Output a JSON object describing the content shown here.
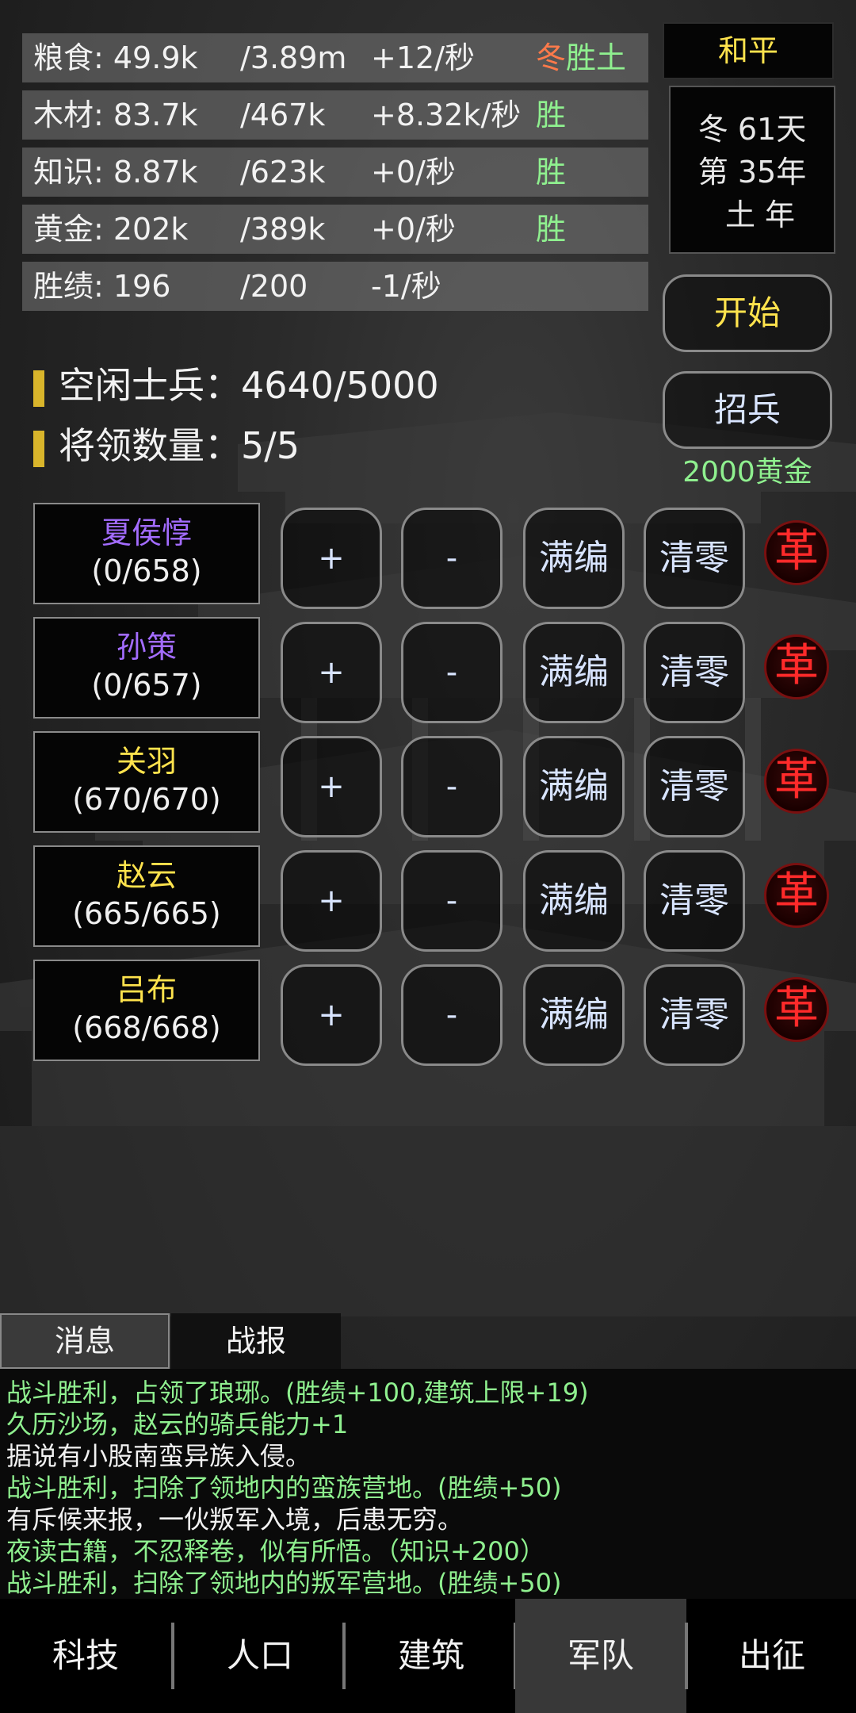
{
  "resources": [
    {
      "name": "粮食: 49.9k",
      "max": "/3.89m",
      "rate": "+12/秒",
      "tag_winter": "冬",
      "tag_victory": "胜",
      "tag_earth": "土"
    },
    {
      "name": "木材: 83.7k",
      "max": "/467k",
      "rate": "+8.32k/秒",
      "tag": "胜"
    },
    {
      "name": "知识: 8.87k",
      "max": "/623k",
      "rate": "+0/秒",
      "tag": "胜"
    },
    {
      "name": "黄金: 202k",
      "max": "/389k",
      "rate": "+0/秒",
      "tag": "胜"
    },
    {
      "name": "胜绩: 196",
      "max": "/200",
      "rate": "-1/秒",
      "tag": ""
    }
  ],
  "status": {
    "peace": "和平",
    "calendar": [
      "冬 61天",
      "第 35年",
      "土 年"
    ]
  },
  "actions": {
    "start": "开始",
    "recruit": "招兵",
    "recruit_cost": "2000黄金"
  },
  "soldiers": {
    "idle": "空闲士兵：4640/5000",
    "generals_count": "将领数量：5/5"
  },
  "general_buttons": {
    "plus": "+",
    "minus": "-",
    "full": "满编",
    "clear": "清零",
    "remove": "革"
  },
  "generals": [
    {
      "name": "夏侯惇",
      "troops": "(0/658)",
      "color": "#a36cff"
    },
    {
      "name": "孙策",
      "troops": "(0/657)",
      "color": "#a36cff"
    },
    {
      "name": "关羽",
      "troops": "(670/670)",
      "color": "#ffe34d"
    },
    {
      "name": "赵云",
      "troops": "(665/665)",
      "color": "#ffe34d"
    },
    {
      "name": "吕布",
      "troops": "(668/668)",
      "color": "#ffe34d"
    }
  ],
  "tabs": {
    "messages": "消息",
    "battle": "战报"
  },
  "log": [
    {
      "text": "战斗胜利，占领了琅琊。(胜绩+100,建筑上限+19)",
      "color": "green"
    },
    {
      "text": "久历沙场，赵云的骑兵能力+1",
      "color": "green"
    },
    {
      "text": "据说有小股南蛮异族入侵。",
      "color": "white"
    },
    {
      "text": "战斗胜利，扫除了领地内的蛮族营地。(胜绩+50)",
      "color": "green"
    },
    {
      "text": "有斥候来报，一伙叛军入境，后患无穷。",
      "color": "white"
    },
    {
      "text": "夜读古籍，不忍释卷，似有所悟。（知识+200）",
      "color": "green"
    },
    {
      "text": "战斗胜利，扫除了领地内的叛军营地。(胜绩+50)",
      "color": "green"
    }
  ],
  "nav": [
    "科技",
    "人口",
    "建筑",
    "军队",
    "出征"
  ],
  "nav_active": "军队"
}
